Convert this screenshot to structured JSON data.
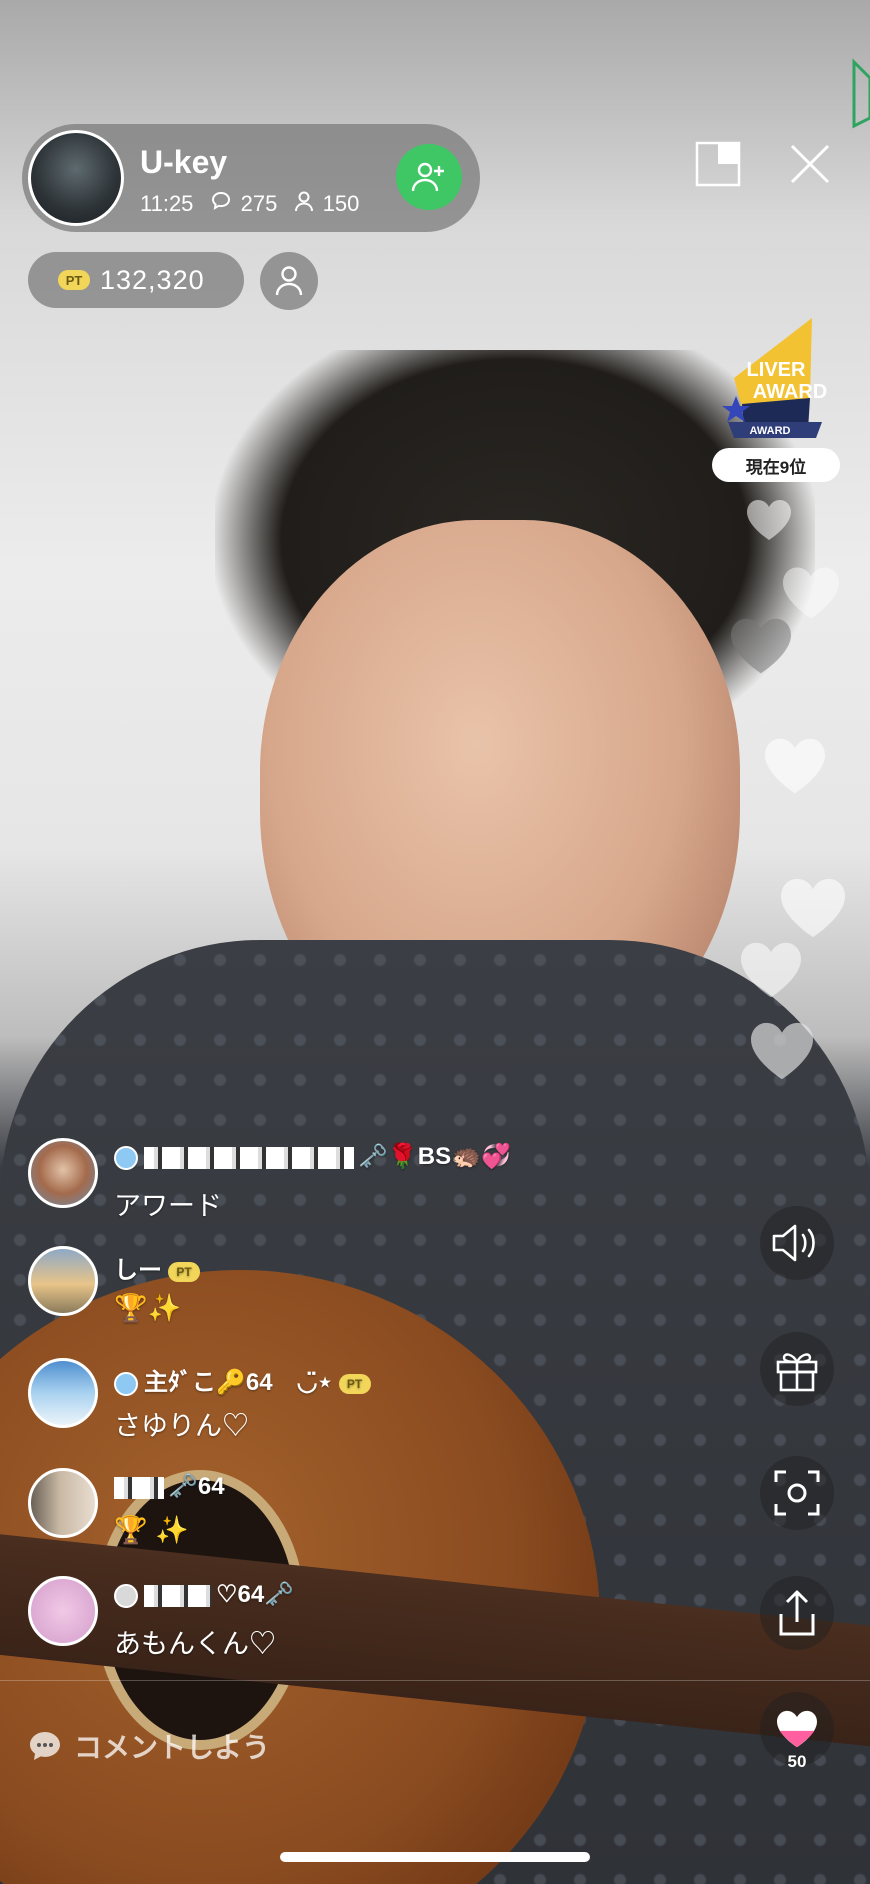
{
  "host": {
    "name": "U-key",
    "elapsed": "11:25",
    "comment_count": "275",
    "viewer_count": "150"
  },
  "points": {
    "badge": "PT",
    "value": "132,320"
  },
  "award": {
    "line1": "LIVER",
    "line2": "AWARD",
    "ribbon": "AWARD",
    "rank": "現在9位"
  },
  "comments": [
    {
      "name_tail": "🗝️🌹BS🦔💞",
      "text": "アワード",
      "badge": "blue-diamond"
    },
    {
      "name": "しー",
      "name_badge": "PT",
      "text": "🏆✨"
    },
    {
      "name": "主ﾀﾞこ🔑64　◡̈⋆",
      "name_badge": "PT",
      "text": "さゆりん♡",
      "badge": "blue-diamond"
    },
    {
      "name_tail": "🗝️64",
      "text": "🏆 ✨"
    },
    {
      "name_tail": "♡64🗝️",
      "text": "あもんくん♡",
      "badge": "silver-diamond"
    }
  ],
  "controls": {
    "like_count": "50",
    "icons": [
      "speaker-icon",
      "gift-icon",
      "screenshot-icon",
      "share-icon",
      "heart-icon"
    ]
  },
  "comment_input": {
    "placeholder": "コメントしよう"
  },
  "colors": {
    "follow_green": "#3fc766",
    "pt_yellow": "#f2d65a",
    "like_pink": "#ff5f9e"
  }
}
